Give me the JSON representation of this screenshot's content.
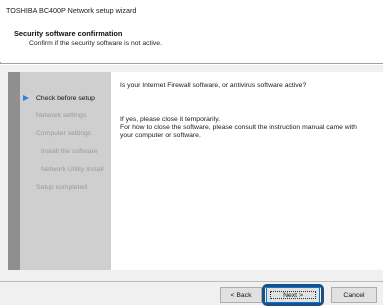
{
  "window": {
    "title": "TOSHIBA BC400P Network setup wizard"
  },
  "header": {
    "title": "Security software confirmation",
    "subtitle": "Confirm if the security software is not active."
  },
  "sidebar": {
    "steps": [
      {
        "label": "Check before setup",
        "state": "active"
      },
      {
        "label": "Network settings",
        "state": "inactive"
      },
      {
        "label": "Computer settings",
        "state": "inactive"
      },
      {
        "label": "Install the software",
        "state": "inactive"
      },
      {
        "label": "Network Utility install",
        "state": "inactive"
      },
      {
        "label": "Setup completed",
        "state": "inactive"
      }
    ],
    "active_marker_icon": "arrow-right-icon"
  },
  "content": {
    "question": "Is your Internet Firewall software, or antivirus software active?",
    "instructions": [
      "If yes, please close it temporarily.",
      "For how to close the software, please consult the instruction manual came with",
      "your computer or software."
    ]
  },
  "footer": {
    "back_label": "< Back",
    "next_label": "Next >",
    "cancel_label": "Cancel"
  },
  "colors": {
    "highlight": "#1e4d86",
    "active_marker": "#2e7fe0",
    "sidebar_bg": "#cfcfcf"
  }
}
